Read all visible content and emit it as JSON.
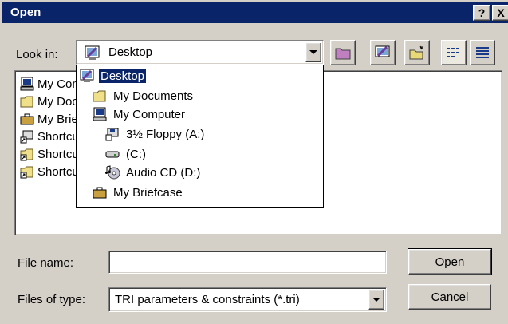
{
  "window": {
    "title": "Open",
    "help_btn": "?",
    "close_btn": "X"
  },
  "lookin": {
    "label": "Look in:",
    "value": "Desktop"
  },
  "file_list": [
    {
      "label": "My Computer",
      "icon": "computer-icon"
    },
    {
      "label": "My Documents",
      "icon": "folder-icon"
    },
    {
      "label": "My Briefcase",
      "icon": "briefcase-icon"
    },
    {
      "label": "Shortcut",
      "icon": "shortcut-icon"
    },
    {
      "label": "Shortcut",
      "icon": "shortcut-folder-icon"
    },
    {
      "label": "Shortcut",
      "icon": "shortcut-folder-icon"
    }
  ],
  "dropdown": [
    {
      "label": "Desktop",
      "icon": "desktop-icon",
      "selected": true
    },
    {
      "label": "My Documents",
      "icon": "folder-icon"
    },
    {
      "label": "My Computer",
      "icon": "computer-icon"
    },
    {
      "label": "3½ Floppy (A:)",
      "icon": "floppy-icon"
    },
    {
      "label": "(C:)",
      "icon": "drive-icon"
    },
    {
      "label": "Audio CD (D:)",
      "icon": "cd-icon"
    },
    {
      "label": "My Briefcase",
      "icon": "briefcase-icon"
    }
  ],
  "filename": {
    "label": "File name:",
    "value": ""
  },
  "filetype": {
    "label": "Files of type:",
    "value": "TRI parameters & constraints (*.tri)"
  },
  "buttons": {
    "open": "Open",
    "cancel": "Cancel"
  }
}
